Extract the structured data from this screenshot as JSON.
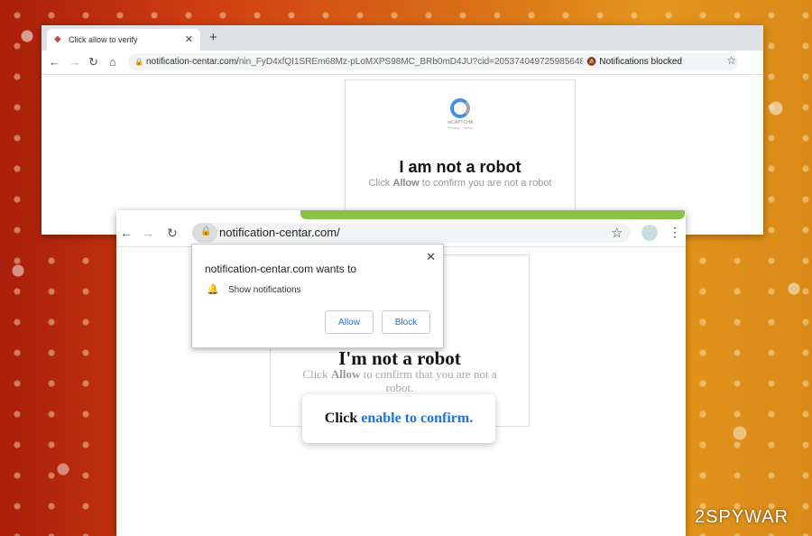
{
  "top_window": {
    "tab_title": "Click allow to verify",
    "url": "notification-centar.com/",
    "url_path": "nin_FyD4xfQI1SREm68Mz-pLoMXPS98MC_BRb0mD4JU?cid=205374049725985648&...",
    "notifications_blocked": "Notifications blocked",
    "recaptcha_label": "reCAPTCHA",
    "recaptcha_sub": "Privacy - Terms",
    "heading": "I am not a robot",
    "sub_prefix": "Click ",
    "sub_bold": "Allow",
    "sub_suffix": " to confirm you are not a robot"
  },
  "bottom_window": {
    "url": "notification-centar.com/",
    "heading": "I'm not a robot",
    "sub_prefix": "Click ",
    "sub_bold": "Allow",
    "sub_suffix": " to confirm that you are not a robot.",
    "popup_title": "notification-centar.com wants to",
    "popup_permission": "Show notifications",
    "allow_label": "Allow",
    "block_label": "Block",
    "toast_prefix": "Click ",
    "toast_link": "enable to confirm."
  },
  "watermark": "2SPYWAR"
}
